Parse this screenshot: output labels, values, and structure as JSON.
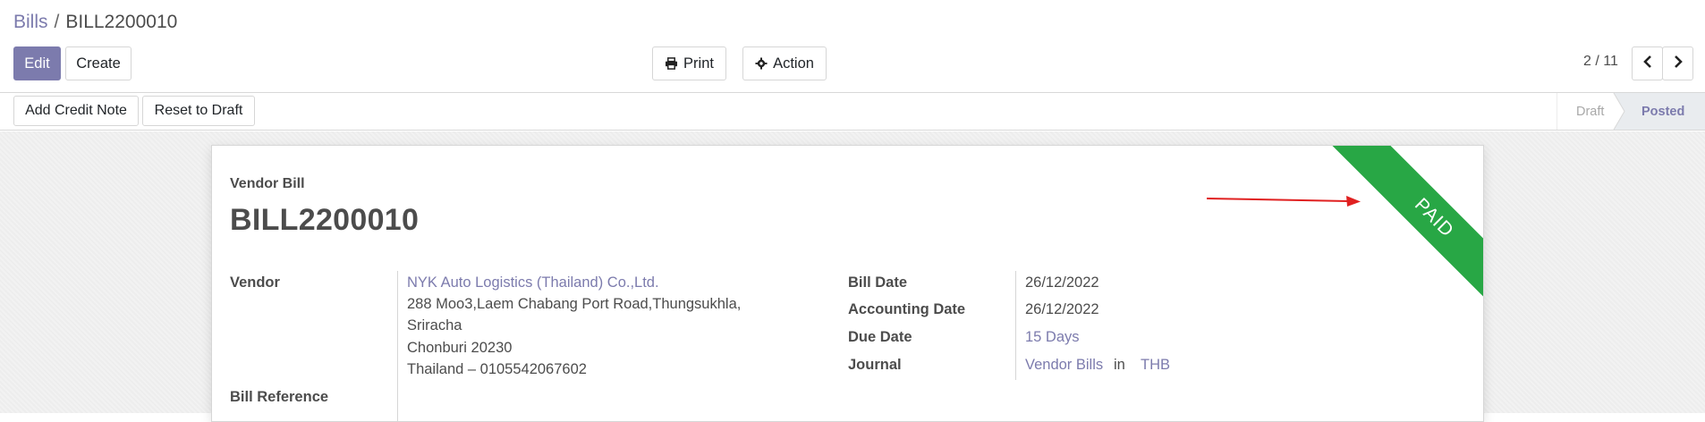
{
  "breadcrumb": {
    "parent": "Bills",
    "separator": "/",
    "current": "BILL2200010"
  },
  "toolbar": {
    "edit_label": "Edit",
    "create_label": "Create",
    "print_label": "Print",
    "action_label": "Action"
  },
  "pager": {
    "value": "2 / 11"
  },
  "status_bar": {
    "add_credit_note_label": "Add Credit Note",
    "reset_to_draft_label": "Reset to Draft",
    "stages": [
      "Draft",
      "Posted"
    ],
    "active_stage": "Posted"
  },
  "document": {
    "type_label": "Vendor Bill",
    "name": "BILL2200010",
    "ribbon": "PAID",
    "vendor_label": "Vendor",
    "vendor_name": "NYK Auto Logistics (Thailand) Co.,Ltd.",
    "vendor_address": [
      "288 Moo3,Laem Chabang Port Road,Thungsukhla,",
      "Sriracha",
      "Chonburi 20230",
      "Thailand – 0105542067602"
    ],
    "bill_reference_label": "Bill Reference",
    "bill_date_label": "Bill Date",
    "bill_date": "26/12/2022",
    "accounting_date_label": "Accounting Date",
    "accounting_date": "26/12/2022",
    "due_date_label": "Due Date",
    "due_date": "15 Days",
    "journal_label": "Journal",
    "journal": "Vendor Bills",
    "journal_in": "in",
    "currency": "THB"
  },
  "colors": {
    "brand": "#7c7bad",
    "paid_ribbon": "#28a745",
    "annotation_arrow": "#e02020"
  },
  "icons": {
    "print": "printer-icon",
    "action": "gear-icon",
    "prev": "chevron-left-icon",
    "next": "chevron-right-icon"
  }
}
